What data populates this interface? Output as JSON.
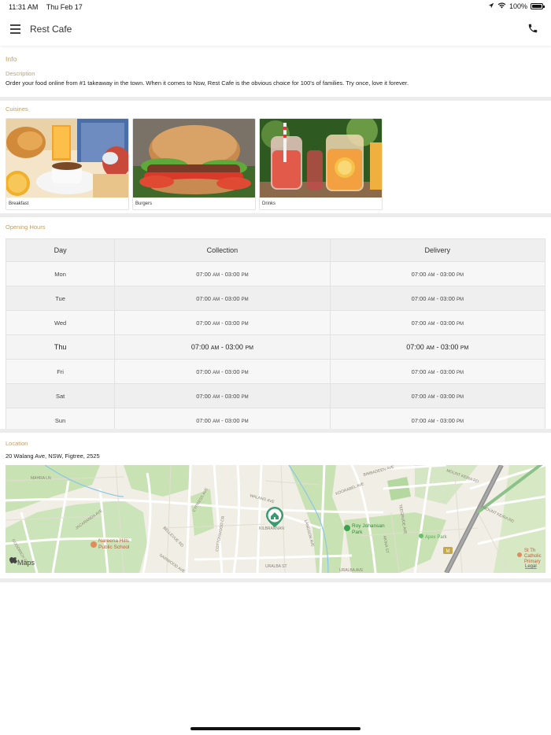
{
  "status_bar": {
    "time": "11:31 AM",
    "date": "Thu Feb 17",
    "battery_percent": "100%",
    "battery_level": 1.0
  },
  "header": {
    "title": "Rest Cafe"
  },
  "info": {
    "heading": "Info",
    "description_label": "Description",
    "description": "Order your food online from #1 takeaway in the town. When it comes to Nsw, Rest Cafe is the obvious choice for 100's of families. Try once, love it forever."
  },
  "cuisines": {
    "label": "Cuisines",
    "items": [
      {
        "name": "Breakfast",
        "icon": "breakfast-photo"
      },
      {
        "name": "Burgers",
        "icon": "burger-photo"
      },
      {
        "name": "Drinks",
        "icon": "drinks-photo"
      }
    ]
  },
  "opening_hours": {
    "label": "Opening Hours",
    "columns": [
      "Day",
      "Collection",
      "Delivery"
    ],
    "rows": [
      {
        "day": "Mon",
        "col_start": "07:00",
        "col_end": "03:00",
        "del_start": "07:00",
        "del_end": "03:00"
      },
      {
        "day": "Tue",
        "col_start": "07:00",
        "col_end": "03:00",
        "del_start": "07:00",
        "del_end": "03:00"
      },
      {
        "day": "Wed",
        "col_start": "07:00",
        "col_end": "03:00",
        "del_start": "07:00",
        "del_end": "03:00"
      },
      {
        "day": "Thu",
        "col_start": "07:00",
        "col_end": "03:00",
        "del_start": "07:00",
        "del_end": "03:00"
      },
      {
        "day": "Fri",
        "col_start": "07:00",
        "col_end": "03:00",
        "del_start": "07:00",
        "del_end": "03:00"
      },
      {
        "day": "Sat",
        "col_start": "07:00",
        "col_end": "03:00",
        "del_start": "07:00",
        "del_end": "03:00"
      },
      {
        "day": "Sun",
        "col_start": "07:00",
        "col_end": "03:00",
        "del_start": "07:00",
        "del_end": "03:00"
      }
    ],
    "am": "AM",
    "pm": "PM"
  },
  "location": {
    "label": "Location",
    "address": "20 Walang Ave, NSW, Figtree, 2525",
    "map": {
      "maps_logo": "Maps",
      "legal": "Legal",
      "school_label_1": "Nareena Hills",
      "school_label_2": "Public School",
      "park_label_1": "Roy Johansan",
      "park_label_2": "Park",
      "apex_park": "Apex Park",
      "catholic_1": "St Th",
      "catholic_2": "Catholic",
      "catholic_3": "Primary",
      "streets": [
        "MAHRA LN",
        "JACARANDA AVE",
        "GOODRICH ST",
        "BRIAR CT",
        "CYPRESS AVE",
        "COTTONWOOD CR",
        "BELLEVUE RD",
        "SAINWOOD AVE",
        "URALBA ST",
        "KILBRANNAN",
        "WALANG AVE",
        "LAKEWOOD RD",
        "LANGSON AVE",
        "KOORABEL AVE",
        "BIMBADEEN AVE",
        "MOUNT KEIRA RD",
        "AKINA ST",
        "TEEGRUDE AVE",
        "ST TULIP ST",
        "URALBA AVE",
        "MOUNT KEIRA RD",
        "KENSIRAC RD",
        "HOSPISTA ST",
        "TAMIA RD",
        "NEWS DR",
        "NAFAL AVE"
      ],
      "route_number": "M"
    }
  },
  "colors": {
    "accent": "#c0a066",
    "map_pin": "#3a9a6e"
  }
}
